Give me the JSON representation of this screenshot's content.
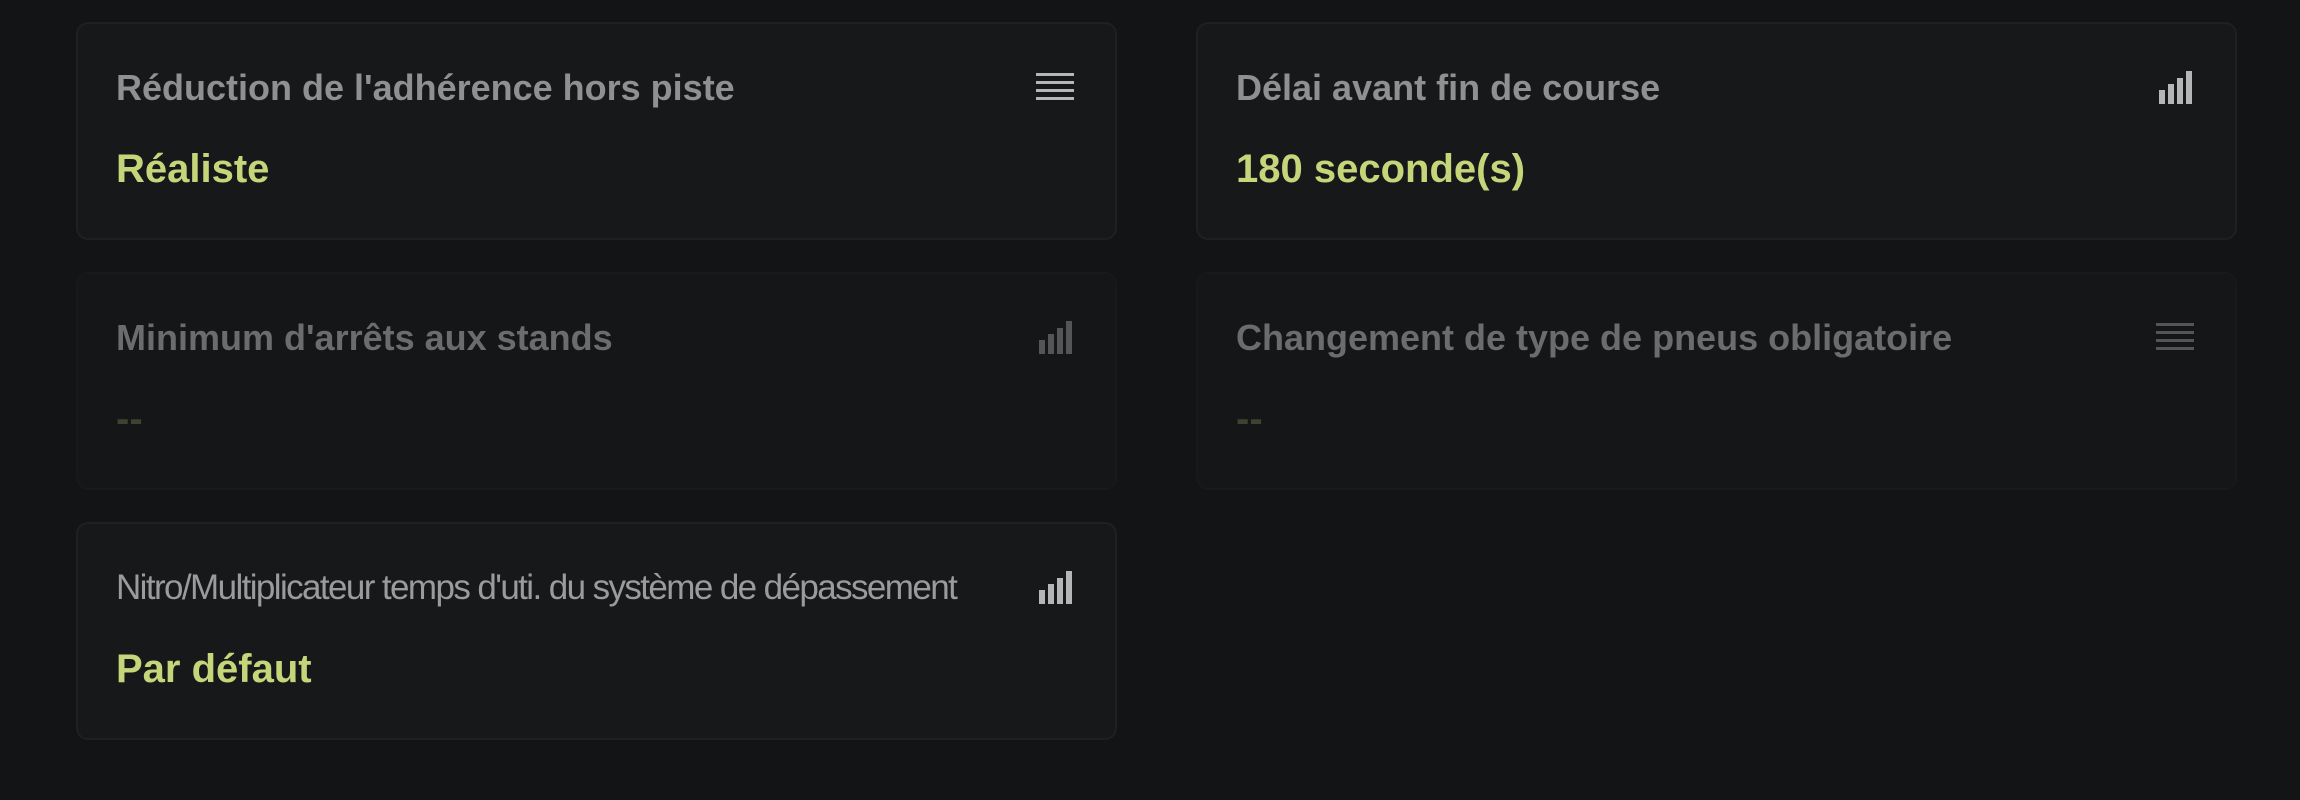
{
  "colors": {
    "background": "#131415",
    "card": "#17181a",
    "title": "#8f9091",
    "value_accent": "#c7d57a",
    "icon": "#b5b6b7"
  },
  "settings": [
    {
      "title": "Réduction de l'adhérence hors piste",
      "value": "Réaliste",
      "icon": "list-icon",
      "enabled": true
    },
    {
      "title": "Délai avant fin de course",
      "value": "180 seconde(s)",
      "icon": "signal-bars-icon",
      "enabled": true
    },
    {
      "title": "Minimum d'arrêts aux stands",
      "value": "--",
      "icon": "signal-bars-icon",
      "enabled": false
    },
    {
      "title": "Changement de type de pneus obligatoire",
      "value": "--",
      "icon": "list-icon",
      "enabled": false
    },
    {
      "title": "Nitro/Multiplicateur temps d'uti. du système de dépassement",
      "value": "Par défaut",
      "icon": "signal-bars-icon",
      "enabled": true
    }
  ]
}
